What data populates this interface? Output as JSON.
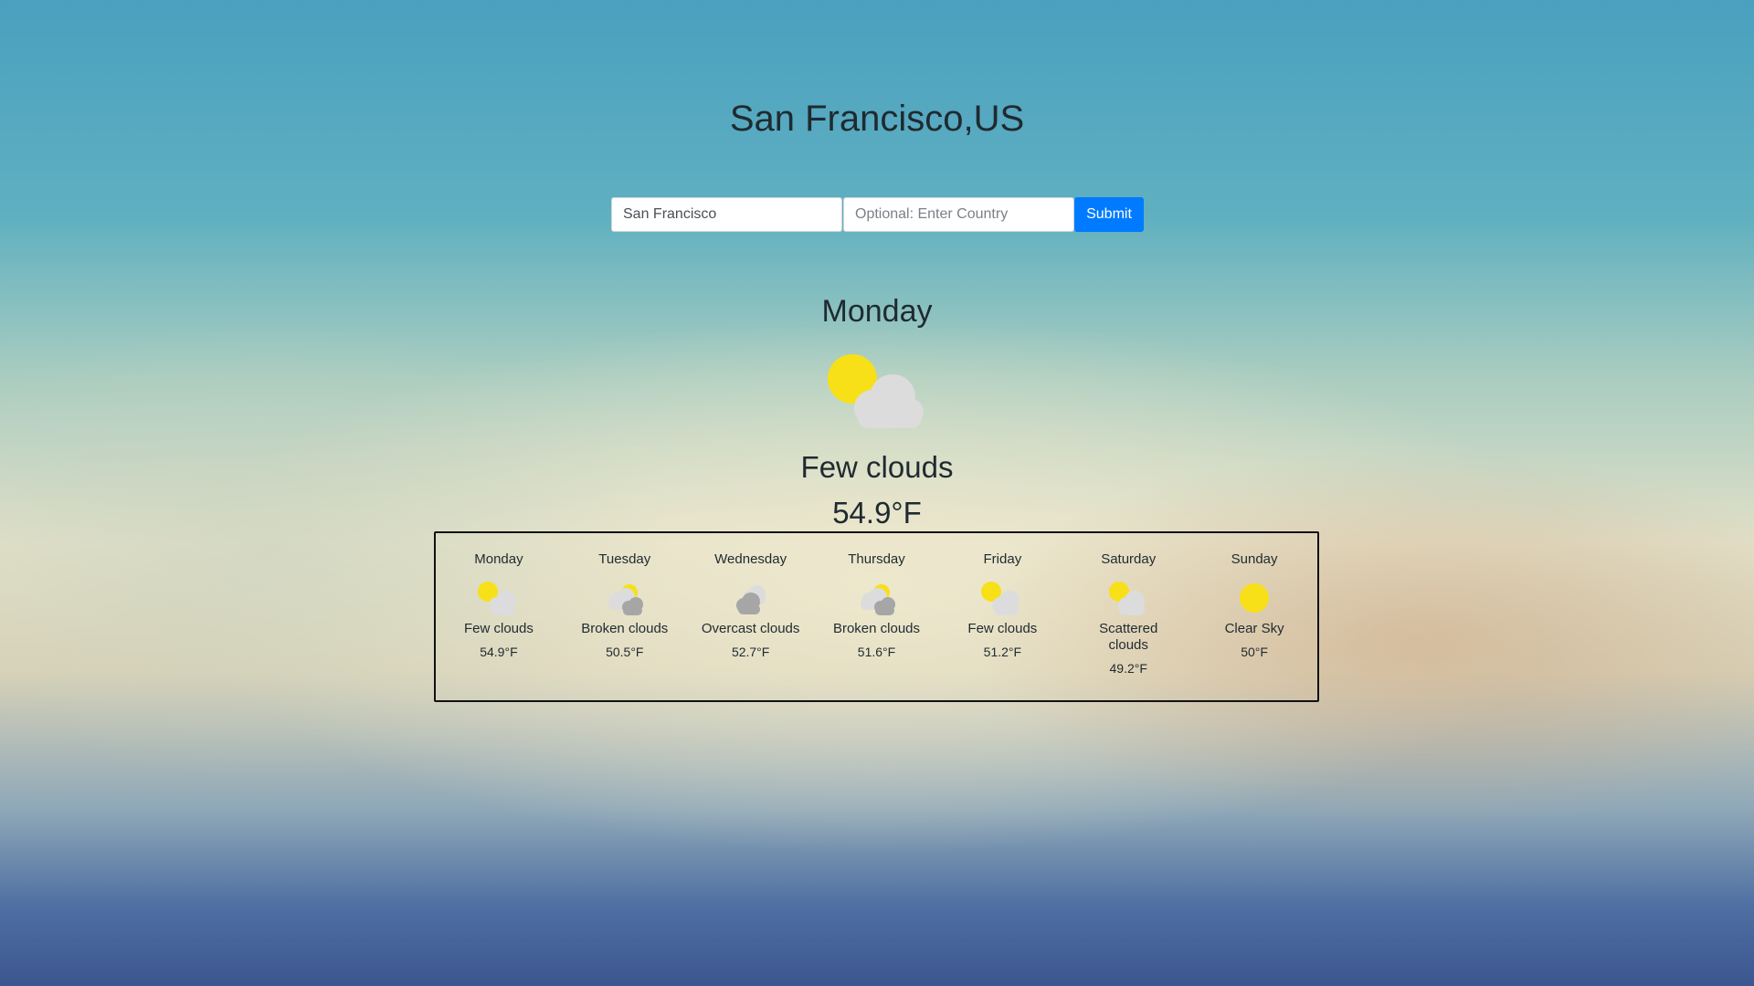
{
  "header": {
    "title": "San Francisco,US"
  },
  "search": {
    "city_value": "San Francisco",
    "city_placeholder": "",
    "country_value": "",
    "country_placeholder": "Optional: Enter Country",
    "submit_label": "Submit",
    "submit_color": "#007bff"
  },
  "current": {
    "day": "Monday",
    "icon": "few-clouds-icon",
    "description": "Few clouds",
    "temperature": "54.9°F"
  },
  "forecast": [
    {
      "day": "Monday",
      "icon": "few-clouds-icon",
      "description": "Few clouds",
      "temperature": "54.9°F"
    },
    {
      "day": "Tuesday",
      "icon": "broken-clouds-icon",
      "description": "Broken clouds",
      "temperature": "50.5°F"
    },
    {
      "day": "Wednesday",
      "icon": "overcast-clouds-icon",
      "description": "Overcast clouds",
      "temperature": "52.7°F"
    },
    {
      "day": "Thursday",
      "icon": "broken-clouds-icon",
      "description": "Broken clouds",
      "temperature": "51.6°F"
    },
    {
      "day": "Friday",
      "icon": "few-clouds-icon",
      "description": "Few clouds",
      "temperature": "51.2°F"
    },
    {
      "day": "Saturday",
      "icon": "scattered-clouds-icon",
      "description": "Scattered clouds",
      "temperature": "49.2°F"
    },
    {
      "day": "Sunday",
      "icon": "clear-sky-icon",
      "description": "Clear Sky",
      "temperature": "50°F"
    }
  ],
  "colors": {
    "sun": "#f7e017",
    "cloud_light": "#dcdcdc",
    "cloud_dark": "#a6a6a6"
  }
}
